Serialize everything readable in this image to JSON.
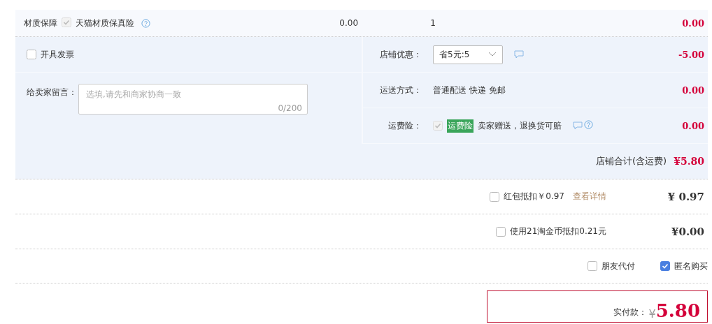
{
  "items": [
    {
      "label": "材质保障",
      "checked": true,
      "disabled": true,
      "name": "天猫材质保真险",
      "price": "0.00",
      "quantity": "1",
      "subtotal": "0.00"
    }
  ],
  "invoice": {
    "label": "开具发票",
    "checked": false
  },
  "message": {
    "label": "给卖家留言：",
    "placeholder": "选填,请先和商家协商一致",
    "counter": "0/200"
  },
  "shop_rows": [
    {
      "kind": "select",
      "label": "店铺优惠：",
      "value": "省5元:5",
      "amount": "-5.00"
    },
    {
      "kind": "text",
      "label": "运送方式：",
      "value": "普通配送 快递 免邮",
      "amount": "0.00"
    },
    {
      "kind": "insurance",
      "label": "运费险：",
      "checked": true,
      "disabled": true,
      "tag": "运费险",
      "value": "卖家赠送，退换货可赔",
      "amount": "0.00"
    }
  ],
  "shop_total": {
    "label": "店铺合计(含运费)",
    "amount": "¥5.80"
  },
  "discounts": [
    {
      "label": "红包抵扣￥0.97",
      "link": "查看详情",
      "checked": false,
      "amount": "¥ 0.97"
    },
    {
      "label": "使用21淘金币抵扣0.21元",
      "checked": false,
      "amount": "¥0.00"
    }
  ],
  "options": [
    {
      "label": "朋友代付",
      "checked": false
    },
    {
      "label": "匿名购买",
      "checked": true
    }
  ],
  "pay": {
    "label": "实付款：",
    "currency": "¥",
    "amount": "5.80"
  }
}
